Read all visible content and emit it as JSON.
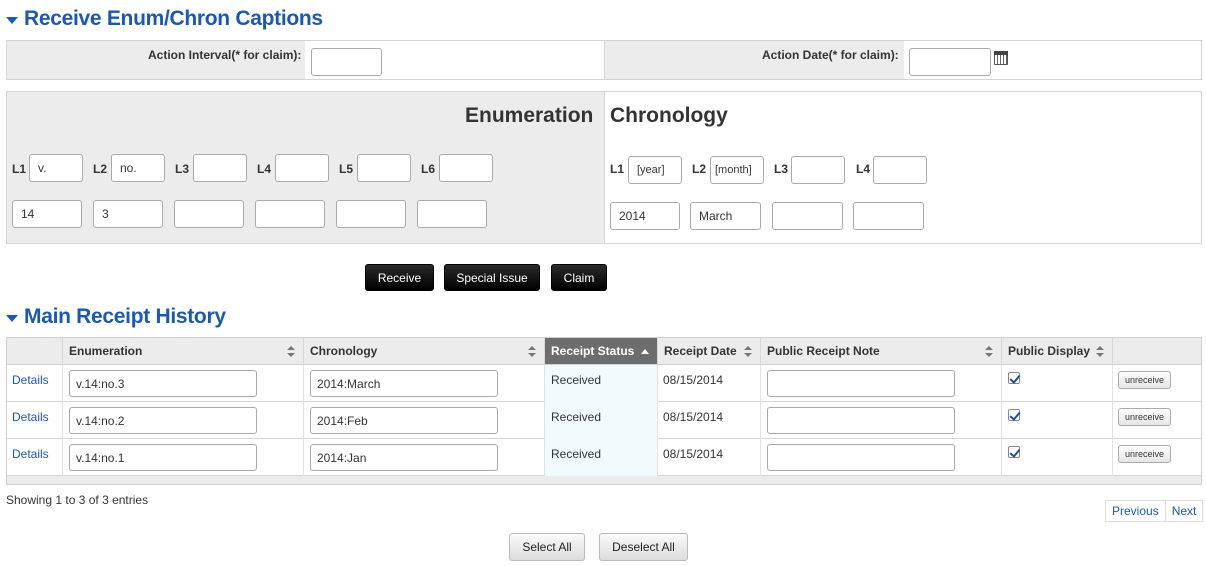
{
  "enum_section": {
    "title": "Receive Enum/Chron Captions",
    "action_interval_label": "Action Interval(* for claim):",
    "action_interval_value": "",
    "action_date_label": "Action Date(* for claim):",
    "action_date_value": "",
    "enumeration_heading": "Enumeration",
    "chronology_heading": "Chronology",
    "enum_levels": [
      {
        "label": "L1",
        "caption": "v.",
        "value": "14"
      },
      {
        "label": "L2",
        "caption": "no.",
        "value": "3"
      },
      {
        "label": "L3",
        "caption": "",
        "value": ""
      },
      {
        "label": "L4",
        "caption": "",
        "value": ""
      },
      {
        "label": "L5",
        "caption": "",
        "value": ""
      },
      {
        "label": "L6",
        "caption": "",
        "value": ""
      }
    ],
    "chron_levels": [
      {
        "label": "L1",
        "caption": "[year]",
        "value": "2014"
      },
      {
        "label": "L2",
        "caption": "[month]",
        "value": "March"
      },
      {
        "label": "L3",
        "caption": "",
        "value": ""
      },
      {
        "label": "L4",
        "caption": "",
        "value": ""
      }
    ],
    "buttons": {
      "receive": "Receive",
      "special_issue": "Special Issue",
      "claim": "Claim"
    }
  },
  "history": {
    "title": "Main Receipt History",
    "columns": [
      "",
      "Enumeration",
      "Chronology",
      "Receipt Status",
      "Receipt Date",
      "Public Receipt Note",
      "Public Display",
      ""
    ],
    "sorted_column": "Receipt Status",
    "rows": [
      {
        "details": "Details",
        "enumeration": "v.14:no.3",
        "chronology": "2014:March",
        "status": "Received",
        "date": "08/15/2014",
        "note": "",
        "public_display": true,
        "action": "unreceive"
      },
      {
        "details": "Details",
        "enumeration": "v.14:no.2",
        "chronology": "2014:Feb",
        "status": "Received",
        "date": "08/15/2014",
        "note": "",
        "public_display": true,
        "action": "unreceive"
      },
      {
        "details": "Details",
        "enumeration": "v.14:no.1",
        "chronology": "2014:Jan",
        "status": "Received",
        "date": "08/15/2014",
        "note": "",
        "public_display": true,
        "action": "unreceive"
      }
    ],
    "info": "Showing 1 to 3 of 3 entries",
    "pager": {
      "previous": "Previous",
      "next": "Next"
    },
    "select_all": "Select All",
    "deselect_all": "Deselect All"
  },
  "colors": {
    "heading": "#1b58b4",
    "link": "#1b58b4",
    "panel": "#ececec",
    "active_header": "#6d6d6d"
  }
}
